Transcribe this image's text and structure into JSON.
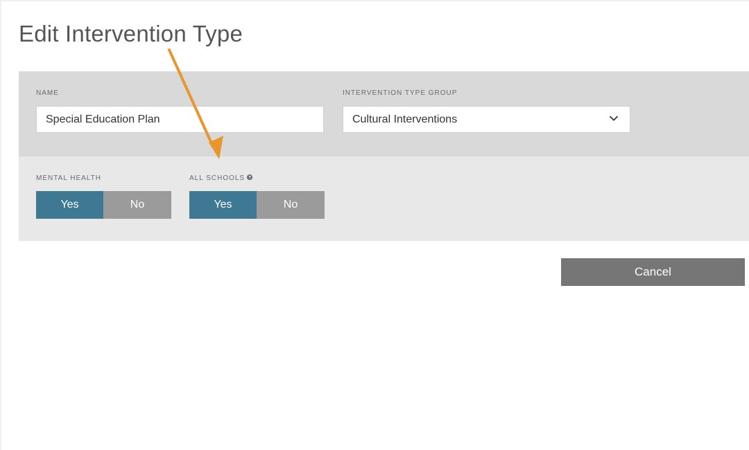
{
  "page": {
    "title": "Edit Intervention Type"
  },
  "form": {
    "name_label": "NAME",
    "name_value": "Special Education Plan",
    "group_label": "INTERVENTION TYPE GROUP",
    "group_value": "Cultural Interventions",
    "mental_health_label": "MENTAL HEALTH",
    "mental_health_yes": "Yes",
    "mental_health_no": "No",
    "mental_health_selected": "Yes",
    "all_schools_label": "ALL SCHOOLS",
    "all_schools_yes": "Yes",
    "all_schools_no": "No",
    "all_schools_selected": "Yes"
  },
  "actions": {
    "cancel_label": "Cancel"
  },
  "icons": {
    "dropdown": "chevron-down-icon",
    "help": "question-circle-icon",
    "annotation": "arrow-icon"
  },
  "colors": {
    "toggle_active": "#3e7892",
    "toggle_inactive": "#9b9b9b",
    "cancel_button": "#767676",
    "annotation_arrow": "#e8962e",
    "panel_dark": "#d9d9d9",
    "panel_light": "#e8e8e8"
  }
}
